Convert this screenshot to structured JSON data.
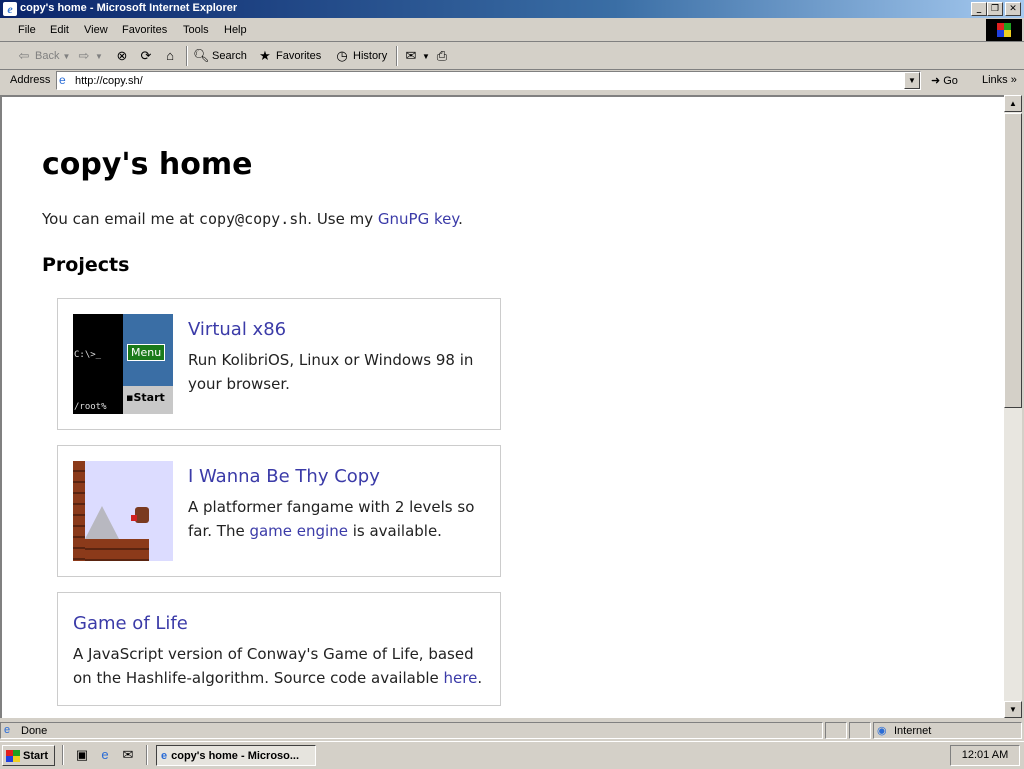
{
  "window": {
    "title": "copy's home - Microsoft Internet Explorer"
  },
  "menu": {
    "items": [
      "File",
      "Edit",
      "View",
      "Favorites",
      "Tools",
      "Help"
    ]
  },
  "toolbar": {
    "back_label": "Back",
    "search_label": "Search",
    "favorites_label": "Favorites",
    "history_label": "History"
  },
  "address": {
    "label": "Address",
    "url": "http://copy.sh/",
    "go_label": "Go",
    "links_label": "Links"
  },
  "page": {
    "title": "copy's home",
    "intro_prefix": "You can email me at ",
    "email": "copy@copy.sh",
    "intro_middle": ". Use my ",
    "gnupg_link": "GnuPG key",
    "intro_suffix": ".",
    "projects_heading": "Projects",
    "projects": [
      {
        "title": "Virtual x86",
        "desc": "Run KolibriOS, Linux or Windows 98 in your browser.",
        "thumb": {
          "prompt": "C:\\>_",
          "root": "/root%",
          "menu": "Menu",
          "start": "Start"
        }
      },
      {
        "title": "I Wanna Be Thy Copy",
        "desc_prefix": "A platformer fangame with 2 levels so far. The ",
        "link": "game engine",
        "desc_suffix": " is available."
      },
      {
        "title": "Game of Life",
        "desc_prefix": "A JavaScript version of Conway's Game of Life, based on the Hashlife-algorithm. Source code available ",
        "link": "here",
        "desc_suffix": "."
      }
    ]
  },
  "status": {
    "text": "Done",
    "zone": "Internet"
  },
  "taskbar": {
    "start_label": "Start",
    "task_label": "copy's home - Microso...",
    "clock": "12:01 AM"
  }
}
